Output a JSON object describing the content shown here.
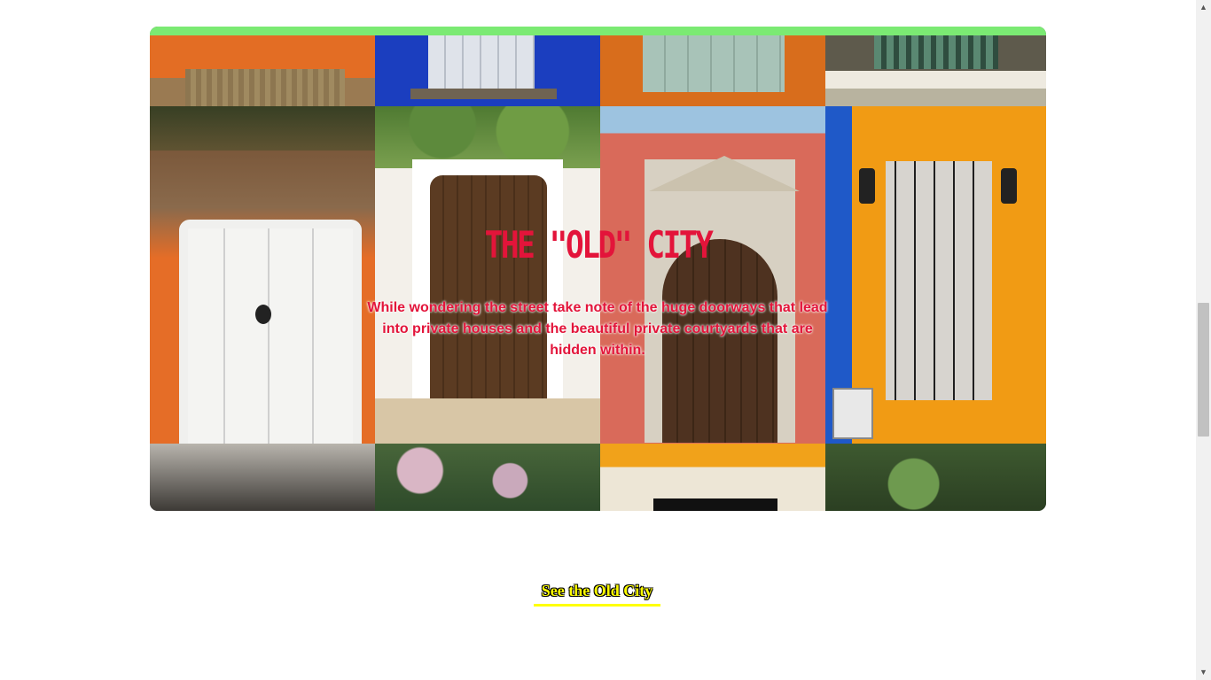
{
  "hero": {
    "title": "THE \"OLD\" CITY",
    "description": "While wondering the street take note of the huge doorways that lead into private houses and the beautiful private courtyards that are hidden within.",
    "accent_bar_color": "#7bea73",
    "text_color": "#e3143a"
  },
  "cta": {
    "label": "See the Old City",
    "color": "#ffff00"
  },
  "scrollbar": {
    "up_icon": "▲",
    "down_icon": "▼"
  }
}
